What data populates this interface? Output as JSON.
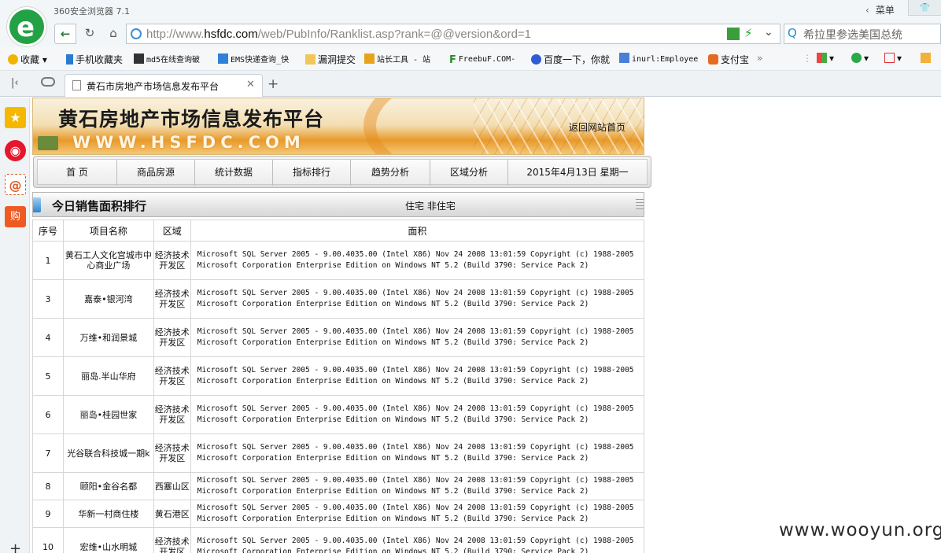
{
  "browser": {
    "app_title": "360安全浏览器 7.1",
    "menu_label": "菜单",
    "url_prefix": "http://www.",
    "url_domain": "hsfdc.com",
    "url_rest": "/web/PubInfo/Ranklist.asp?rank=@@version&ord=1",
    "search_text": "希拉里参选美国总统"
  },
  "bookmarks": [
    {
      "label": "收藏"
    },
    {
      "label": "手机收藏夹"
    },
    {
      "label": "md5在线查询破"
    },
    {
      "label": "EMS快递查询_快"
    },
    {
      "label": "漏洞提交"
    },
    {
      "label": "站长工具 - 站"
    },
    {
      "label": "FreebuF.COM-"
    },
    {
      "label": "百度一下，你就"
    },
    {
      "label": "inurl:Employee"
    },
    {
      "label": "支付宝"
    }
  ],
  "tab": {
    "title": "黄石市房地产市场信息发布平台"
  },
  "site": {
    "title": "黄石房地产市场信息发布平台",
    "domain": "WWW.HSFDC.COM",
    "back_home": "返回网站首页",
    "menu": [
      "首 页",
      "商品房源",
      "统计数据",
      "指标排行",
      "趋势分析",
      "区域分析",
      "2015年4月13日 星期一"
    ]
  },
  "section": {
    "title": "今日销售面积排行",
    "filter": "住宅 非住宅"
  },
  "table": {
    "headers": [
      "序号",
      "项目名称",
      "区域",
      "面积"
    ],
    "version_text": "Microsoft SQL Server 2005 - 9.00.4035.00 (Intel X86) Nov 24 2008 13:01:59 Copyright (c) 1988-2005 Microsoft Corporation Enterprise Edition on Windows NT 5.2 (Build 3790: Service Pack 2)",
    "rows": [
      {
        "no": "1",
        "name": "黄石工人文化宫城市中心商业广场",
        "area": "经济技术开发区"
      },
      {
        "no": "3",
        "name": "嘉泰•银河湾",
        "area": "经济技术开发区"
      },
      {
        "no": "4",
        "name": "万维•和润景城",
        "area": "经济技术开发区"
      },
      {
        "no": "5",
        "name": "丽岛.半山华府",
        "area": "经济技术开发区"
      },
      {
        "no": "6",
        "name": "丽岛•桂园世家",
        "area": "经济技术开发区"
      },
      {
        "no": "7",
        "name": "光谷联合科技城一期k",
        "area": "经济技术开发区"
      },
      {
        "no": "8",
        "name": "颐阳•金谷名都",
        "area": "西塞山区"
      },
      {
        "no": "9",
        "name": "华新一村商住楼",
        "area": "黄石港区"
      },
      {
        "no": "10",
        "name": "宏维•山水明城",
        "area": "经济技术开发区"
      }
    ]
  },
  "watermark": "www.wooyun.org",
  "colors": {
    "brand_green": "#23a245",
    "banner_orange": "#e89a2a"
  }
}
